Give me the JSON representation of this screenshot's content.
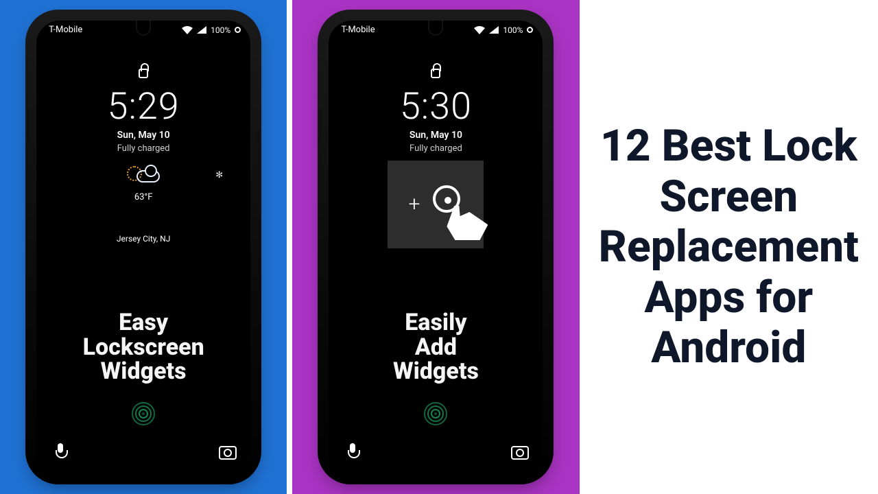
{
  "headline": "12 Best Lock Screen Replacement Apps for Android",
  "panels": {
    "left": {
      "bg": "#1f71d3"
    },
    "mid": {
      "bg": "#a933c2"
    }
  },
  "carrier": "T-Mobile",
  "battery": "100%",
  "phone1": {
    "time": "5:29",
    "date": "Sun, May 10",
    "charge": "Fully charged",
    "temp": "63°F",
    "location": "Jersey City, NJ",
    "promo_line1": "Easy",
    "promo_line2": "Lockscreen",
    "promo_line3": "Widgets"
  },
  "phone2": {
    "time": "5:30",
    "date": "Sun, May 10",
    "charge": "Fully charged",
    "promo_line1": "Easily",
    "promo_line2": "Add",
    "promo_line3": "Widgets"
  }
}
